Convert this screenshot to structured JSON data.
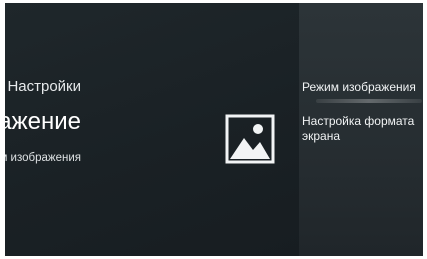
{
  "header": {
    "settings_label": "Настройки",
    "section_title": "Изображение",
    "section_description": "Настройте режим изображения"
  },
  "icons": {
    "section_icon": "image-icon"
  },
  "menu": {
    "items": [
      {
        "label": "Режим изображения",
        "selected": true
      },
      {
        "label": "Настройка формата экрана",
        "selected": false
      }
    ]
  },
  "colors": {
    "screen_background": "#1b2226",
    "menu_panel_background": "#2a3236",
    "text_primary": "#ffffff"
  }
}
